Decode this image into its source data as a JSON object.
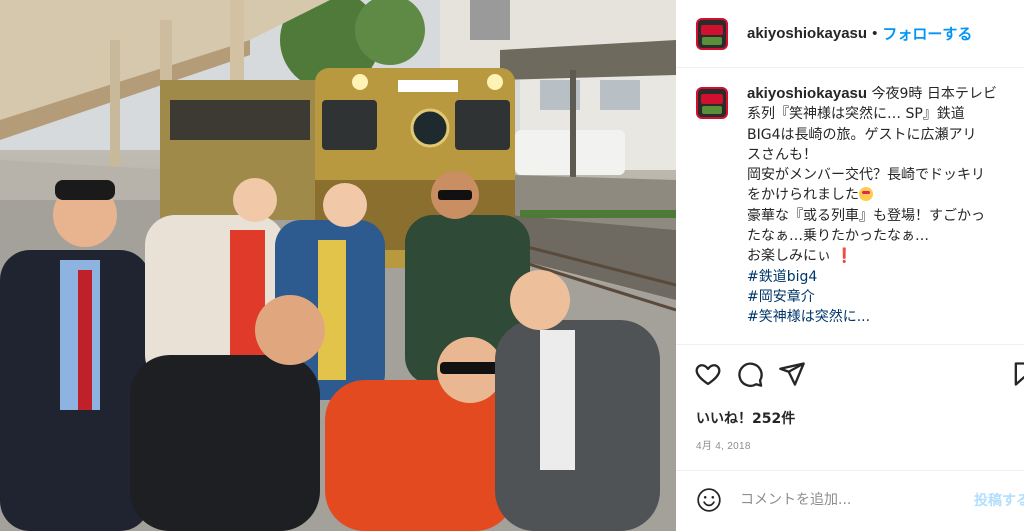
{
  "post": {
    "username": "akiyoshiokayasu",
    "separator": "•",
    "follow_label": "フォローする"
  },
  "caption": {
    "username": "akiyoshiokayasu",
    "lines": [
      " 今夜9時 日本テレビ",
      "系列『笑神様は突然に… SP』鉄道",
      "BIG4は長崎の旅。ゲストに広瀬アリ",
      "スさんも！",
      "岡安がメンバー交代？長崎でドッキリ",
      "をかけられました",
      "豪華な『或る列車』も登場！すごかっ",
      "たなぁ…乗りたかったなぁ…",
      "お楽しみにぃ"
    ],
    "heart_emoji": "❗",
    "hashtags": [
      "#鉄道big4",
      "#岡安章介",
      "#笑神様は突然に..."
    ]
  },
  "actions": {
    "like_icon": "heart-outline-icon",
    "comment_icon": "comment-bubble-icon",
    "share_icon": "paper-plane-icon",
    "save_icon": "bookmark-icon"
  },
  "likes_label": "いいね！252件",
  "date_label": "4月 4, 2018",
  "comment": {
    "placeholder": "コメントを追加...",
    "post_label": "投稿する"
  },
  "colors": {
    "accent": "#0095f6",
    "hashtag": "#00376b",
    "text": "#262626",
    "muted": "#8e8e8e",
    "post_disabled": "#b2dffc"
  }
}
